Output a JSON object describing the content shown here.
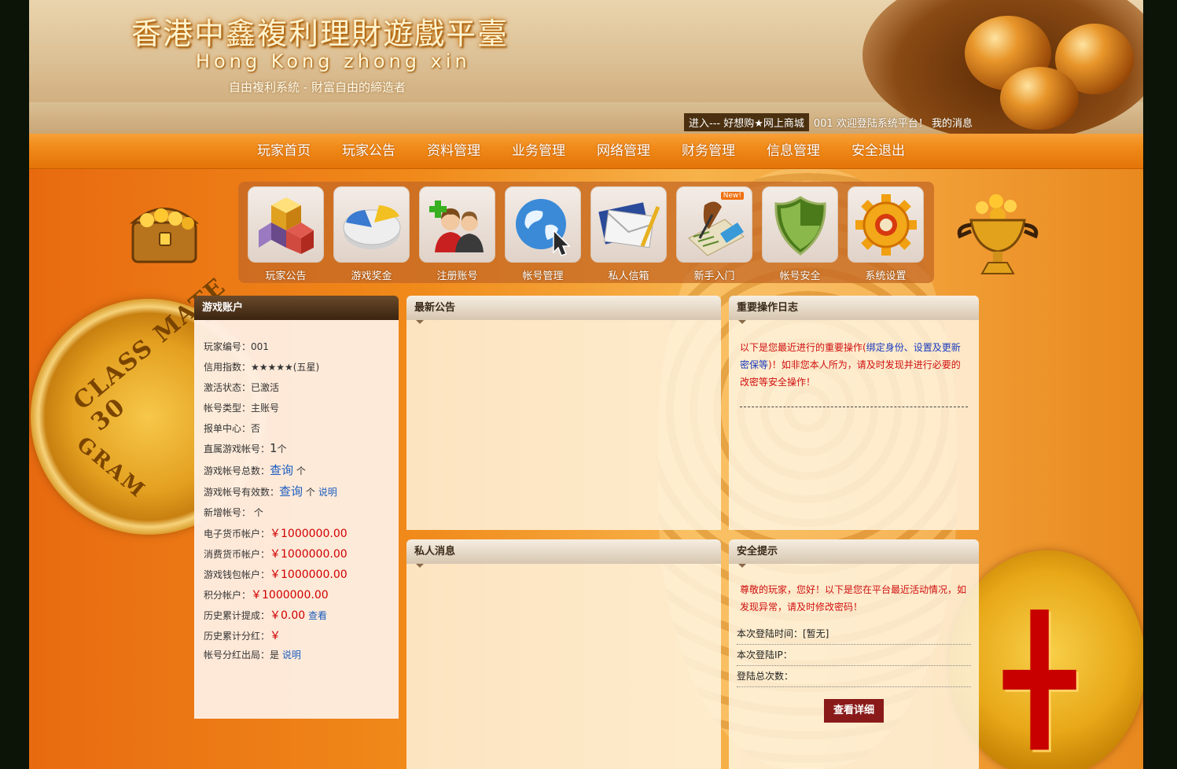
{
  "header": {
    "title": "香港中鑫複利理財遊戲平臺",
    "subtitle": "Hong  Kong  zhong  xin",
    "slogan": "自由複利系統 - 財富自由的締造者",
    "entry_link": "进入--- 好想购★网上商城",
    "welcome_text": "001  欢迎登陆系统平台！ 我的消息"
  },
  "nav": {
    "items": [
      "玩家首页",
      "玩家公告",
      "资料管理",
      "业务管理",
      "网络管理",
      "财务管理",
      "信息管理",
      "安全退出"
    ]
  },
  "icons": {
    "items": [
      {
        "label": "玩家公告",
        "icon": "cubes-icon"
      },
      {
        "label": "游戏奖金",
        "icon": "pie-chart-icon"
      },
      {
        "label": "注册账号",
        "icon": "add-user-icon"
      },
      {
        "label": "帐号管理",
        "icon": "globe-icon"
      },
      {
        "label": "私人信箱",
        "icon": "envelope-icon"
      },
      {
        "label": "新手入门",
        "icon": "writing-icon",
        "badge": "New!"
      },
      {
        "label": "帐号安全",
        "icon": "shield-icon"
      },
      {
        "label": "系统设置",
        "icon": "gear-icon"
      }
    ]
  },
  "account": {
    "title": "游戏账户",
    "rows": [
      {
        "label": "玩家编号：",
        "value": "001"
      },
      {
        "label": "信用指数：",
        "value": "★★★★★(五星)"
      },
      {
        "label": "激活状态：",
        "value": "已激活"
      },
      {
        "label": "帐号类型：",
        "value": "主账号"
      },
      {
        "label": "报单中心：",
        "value": "否"
      },
      {
        "label": "直属游戏帐号：",
        "value": "1",
        "unit": "个"
      },
      {
        "label": "游戏帐号总数：",
        "value": "查询",
        "unit": "个"
      },
      {
        "label": "游戏帐号有效数：",
        "value": "查询",
        "unit": "个",
        "link": "说明"
      },
      {
        "label": "新增帐号：",
        "unit": "个"
      },
      {
        "label": "电子货币帐户：",
        "value": "￥1000000.00"
      },
      {
        "label": "消费货币帐户：",
        "value": "￥1000000.00"
      },
      {
        "label": "游戏钱包帐户：",
        "value": "￥1000000.00"
      },
      {
        "label": "积分帐户：",
        "value": "￥1000000.00"
      },
      {
        "label": "历史累计提成：",
        "value": "￥0.00",
        "link": "查看"
      },
      {
        "label": "历史累计分红：",
        "value": "￥"
      },
      {
        "label": "帐号分红出局：",
        "value": "是",
        "link": "说明"
      }
    ]
  },
  "notice": {
    "title": "最新公告"
  },
  "log": {
    "title": "重要操作日志",
    "text_a": "以下是您最近进行的重要操作(",
    "text_b": "绑定身份、设置及更新密保等",
    "text_c": ")！如非您本人所为，请及时发现并进行必要的改密等安全操作！"
  },
  "message": {
    "title": "私人消息"
  },
  "security": {
    "title": "安全提示",
    "text": "尊敬的玩家，您好！以下是您在平台最近活动情况，如发现异常，请及时修改密码！",
    "rows": [
      "本次登陆时间：[暂无]",
      "本次登陆IP：",
      "登陆总次数："
    ],
    "button": "查看详细"
  },
  "decor": {
    "coin_left_text_top": "CLASS MATE 30",
    "coin_left_text_bottom": "GRAM",
    "coin_right_mark": "╋"
  },
  "colors": {
    "nav_bg": "#f08a18",
    "accent_red": "#d00000",
    "link_blue": "#1a5dc0",
    "button_bg": "#8a1a1a"
  }
}
